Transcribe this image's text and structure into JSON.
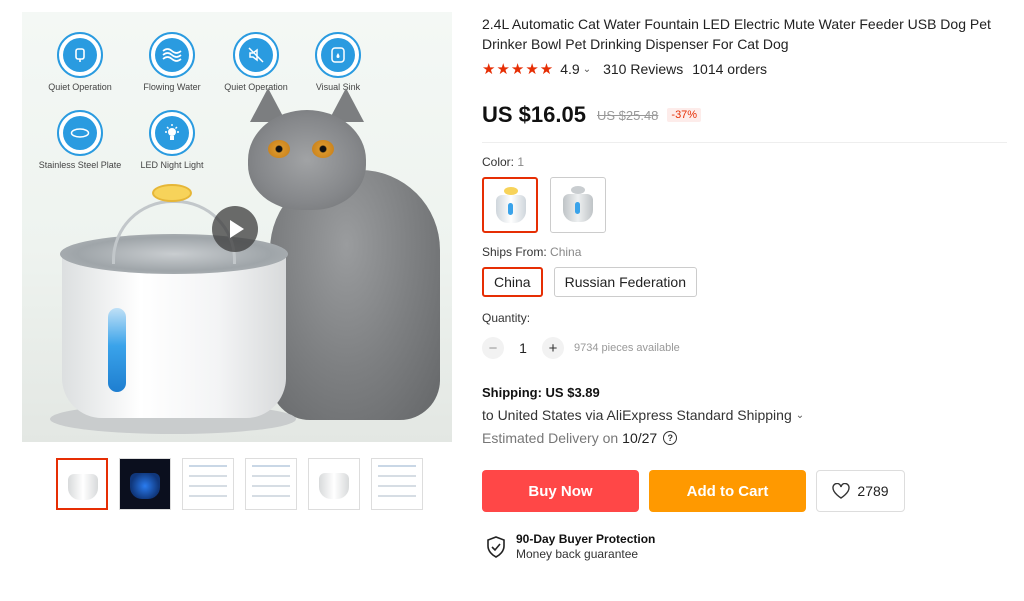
{
  "gallery": {
    "features": [
      {
        "label": "Quiet Operation",
        "icon": "faucet-icon"
      },
      {
        "label": "Flowing Water",
        "icon": "waves-icon"
      },
      {
        "label": "Quiet Operation",
        "icon": "mute-icon"
      },
      {
        "label": "Visual Sink",
        "icon": "water-level-icon"
      },
      {
        "label": "Stainless Steel Plate",
        "icon": "plate-icon"
      },
      {
        "label": "LED Night Light",
        "icon": "light-bulb-icon"
      }
    ],
    "thumbnail_count": 6,
    "active_thumbnail": 0
  },
  "product": {
    "title": "2.4L Automatic Cat Water Fountain LED Electric Mute Water Feeder USB Dog Pet Drinker Bowl Pet Drinking Dispenser For Cat Dog",
    "stars": "★★★★★",
    "rating": "4.9",
    "reviews": "310 Reviews",
    "orders": "1014 orders"
  },
  "price": {
    "current": "US $16.05",
    "original": "US $25.48",
    "discount": "-37%"
  },
  "color": {
    "label": "Color:",
    "value": "1",
    "selected_index": 0
  },
  "ships_from": {
    "label": "Ships From:",
    "value": "China",
    "options": [
      "China",
      "Russian Federation"
    ],
    "selected_index": 0
  },
  "quantity": {
    "label": "Quantity:",
    "minus": "−",
    "value": "1",
    "plus": "+",
    "available": "9734 pieces available"
  },
  "shipping": {
    "title": "Shipping: US $3.89",
    "detail": "to United States via AliExpress Standard Shipping",
    "delivery_label": "Estimated Delivery on",
    "delivery_date": "10/27"
  },
  "actions": {
    "buy_now": "Buy Now",
    "add_to_cart": "Add to Cart",
    "wishlist_count": "2789"
  },
  "protection": {
    "title": "90-Day Buyer Protection",
    "subtitle": "Money back guarantee"
  },
  "colors": {
    "accent": "#e62e04",
    "buy_now": "#ff4747",
    "add_to_cart": "#ff9900",
    "feature_icon": "#2a9be0"
  }
}
